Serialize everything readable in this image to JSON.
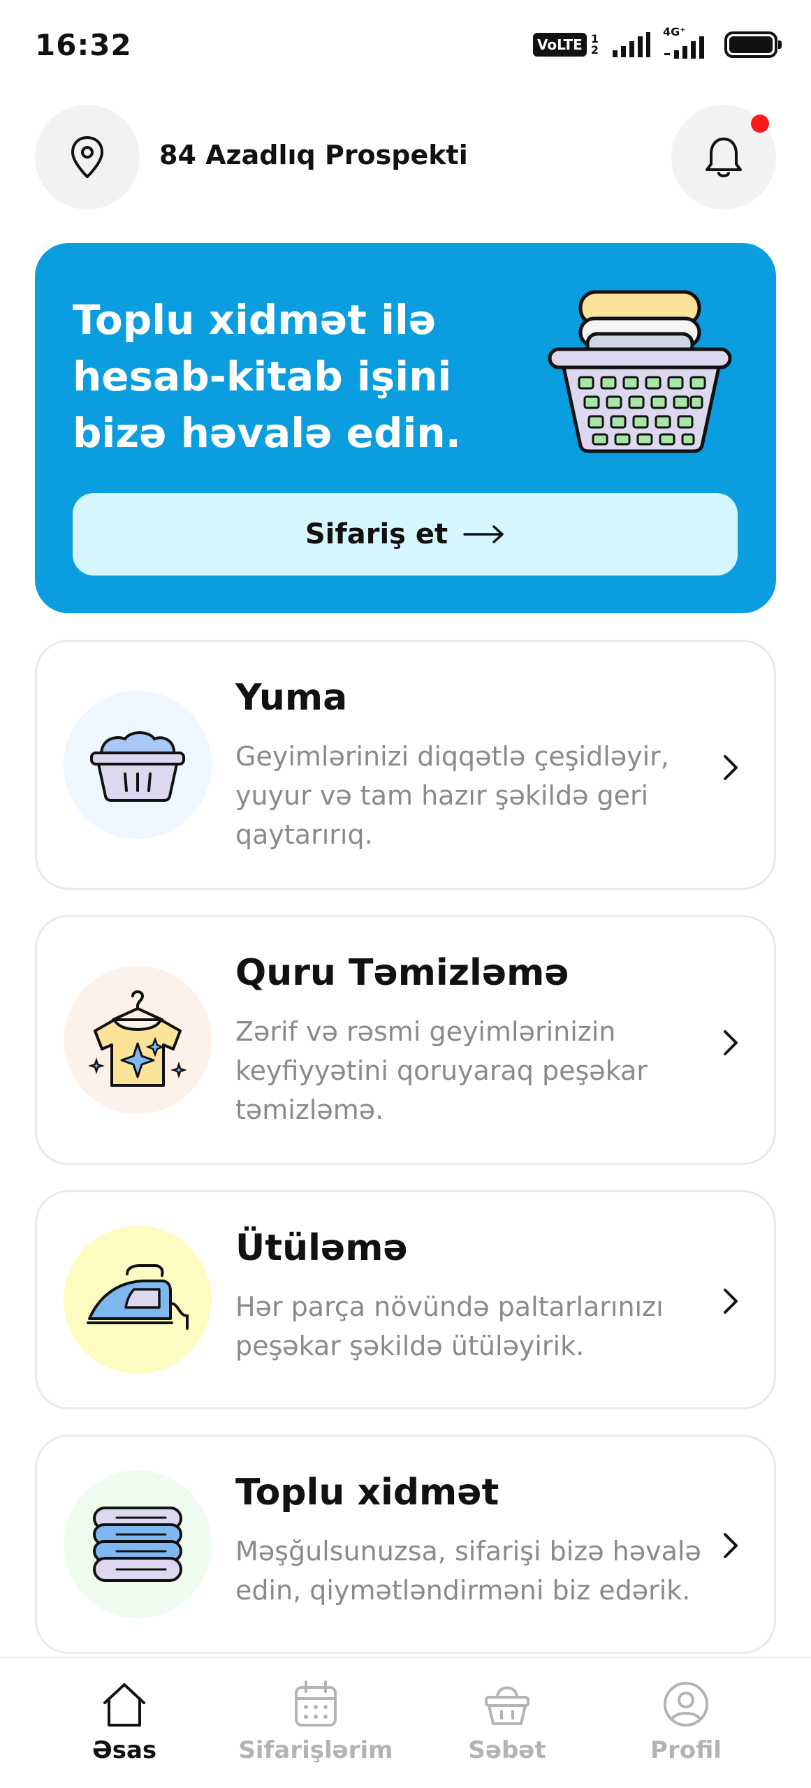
{
  "status_bar": {
    "time": "16:32",
    "volte": "VoLTE",
    "sim_top": "1",
    "sim_bottom": "2",
    "network": "4G⁺"
  },
  "header": {
    "address": "84 Azadlıq Prospekti",
    "location_icon": "location-pin-icon",
    "bell_icon": "bell-icon",
    "has_notification": true
  },
  "banner": {
    "title": "Toplu xidmət ilə hesab-kitab işini bizə həvalə edin.",
    "button_label": "Sifariş et",
    "background": "#0a9de0",
    "button_background": "#d4f6fc"
  },
  "services": [
    {
      "title": "Yuma",
      "description": "Geyimlərinizi diqqətlə çeşidləyir, yuyur və tam hazır şəkildə geri qaytarırıq.",
      "icon": "laundry-basket-icon",
      "icon_bg": "#eef6ff"
    },
    {
      "title": "Quru Təmizləmə",
      "description": "Zərif və rəsmi geyimlərinizin keyfiyyətini qoruyaraq peşəkar təmizləmə.",
      "icon": "shirt-hanger-icon",
      "icon_bg": "#fdf1ea"
    },
    {
      "title": "Ütüləmə",
      "description": "Hər parça növündə paltarlarınızı peşəkar şəkildə ütüləyirik.",
      "icon": "iron-icon",
      "icon_bg": "#fdfbc2"
    },
    {
      "title": "Toplu xidmət",
      "description": "Məşğulsunuzsa, sifarişi bizə həvalə edin, qiymətləndirməni biz edərik.",
      "icon": "folded-clothes-stack-icon",
      "icon_bg": "#eefcef"
    }
  ],
  "bottom_nav": {
    "items": [
      {
        "label": "Əsas",
        "icon": "home-icon",
        "active": true
      },
      {
        "label": "Sifarişlərim",
        "icon": "calendar-icon",
        "active": false
      },
      {
        "label": "Səbət",
        "icon": "basket-icon",
        "active": false
      },
      {
        "label": "Profil",
        "icon": "profile-icon",
        "active": false
      }
    ]
  }
}
